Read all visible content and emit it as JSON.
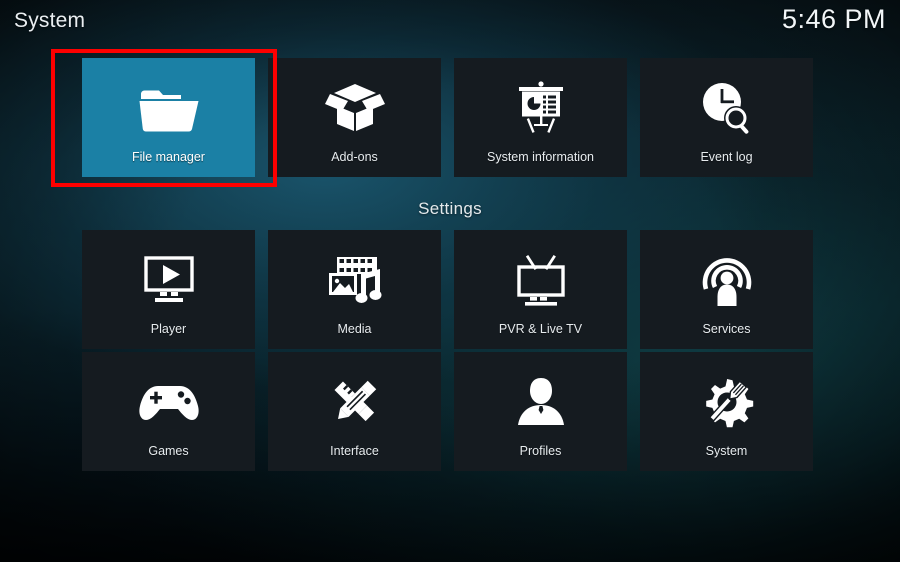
{
  "header": {
    "title": "System",
    "clock": "5:46 PM"
  },
  "section": {
    "heading": "Settings"
  },
  "colors": {
    "selected_tile": "#1b80a5",
    "tile_background": "#151b20",
    "annotation": "#fe0000",
    "text": "#e6ebee"
  },
  "top_row": [
    {
      "label": "File manager",
      "icon": "folder-icon",
      "selected": true
    },
    {
      "label": "Add-ons",
      "icon": "open-box-icon",
      "selected": false
    },
    {
      "label": "System information",
      "icon": "presentation-chart-icon",
      "selected": false
    },
    {
      "label": "Event log",
      "icon": "clock-search-icon",
      "selected": false
    }
  ],
  "settings_rows": [
    [
      {
        "label": "Player",
        "icon": "monitor-play-icon"
      },
      {
        "label": "Media",
        "icon": "film-photo-music-icon"
      },
      {
        "label": "PVR & Live TV",
        "icon": "television-antenna-icon"
      },
      {
        "label": "Services",
        "icon": "broadcast-person-icon"
      }
    ],
    [
      {
        "label": "Games",
        "icon": "gamepad-icon"
      },
      {
        "label": "Interface",
        "icon": "pencil-ruler-icon"
      },
      {
        "label": "Profiles",
        "icon": "person-bust-icon"
      },
      {
        "label": "System",
        "icon": "gear-tool-icon"
      }
    ]
  ]
}
